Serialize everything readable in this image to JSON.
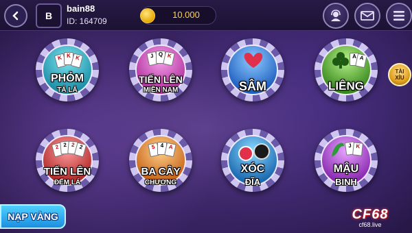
{
  "header": {
    "avatar_letter": "B",
    "username": "bain88",
    "user_id": "ID: 164709",
    "balance": "10.000",
    "icons": [
      "back-arrow-icon",
      "headset-support-icon",
      "mail-icon",
      "menu-icon"
    ]
  },
  "games": [
    {
      "title": "PHỎM",
      "sub": "TÁ LẢ",
      "color": "#39b8c8"
    },
    {
      "title": "TIẾN LÊN",
      "sub": "MIỀN NAM",
      "color": "#d65ac8"
    },
    {
      "title": "SÂM",
      "sub": "",
      "color": "#3a8ce0"
    },
    {
      "title": "LIÊNG",
      "sub": "",
      "color": "#5fb534"
    },
    {
      "title": "TIẾN LÊN",
      "sub": "ĐẾM LÁ",
      "color": "#e25b5b"
    },
    {
      "title": "BA CÂY",
      "sub": "CHƯƠNG",
      "color": "#f08a2a"
    },
    {
      "title": "XÓC",
      "sub": "ĐĨA",
      "color": "#3aa0d8"
    },
    {
      "title": "MẬU",
      "sub": "BINH",
      "color": "#b55ad6"
    }
  ],
  "side_tag": {
    "line1": "TÀI",
    "line2": "XỈU"
  },
  "footer": {
    "deposit_label": "NẠP VÀNG",
    "brand": "CF68",
    "brand_url": "cf68.live"
  }
}
